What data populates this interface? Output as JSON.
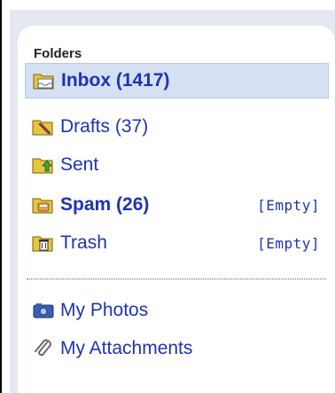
{
  "folders_panel": {
    "title": "Folders",
    "folders": [
      {
        "label": "Inbox (1417)",
        "icon": "inbox-folder-icon",
        "bold": true,
        "selected": true
      },
      {
        "label": "Drafts (37)",
        "icon": "drafts-folder-icon",
        "bold": false,
        "selected": false
      },
      {
        "label": "Sent",
        "icon": "sent-folder-icon",
        "bold": false,
        "selected": false
      },
      {
        "label": "Spam (26)",
        "icon": "spam-folder-icon",
        "bold": true,
        "selected": false,
        "action": "[Empty]"
      },
      {
        "label": "Trash",
        "icon": "trash-folder-icon",
        "bold": false,
        "selected": false,
        "action": "[Empty]"
      }
    ],
    "extras": [
      {
        "label": "My Photos",
        "icon": "photos-icon"
      },
      {
        "label": "My Attachments",
        "icon": "attachment-icon"
      }
    ],
    "colors": {
      "link": "#1f33b3",
      "selected_bg": "#d5e1f3",
      "panel_bg": "#e4e9f1"
    }
  }
}
